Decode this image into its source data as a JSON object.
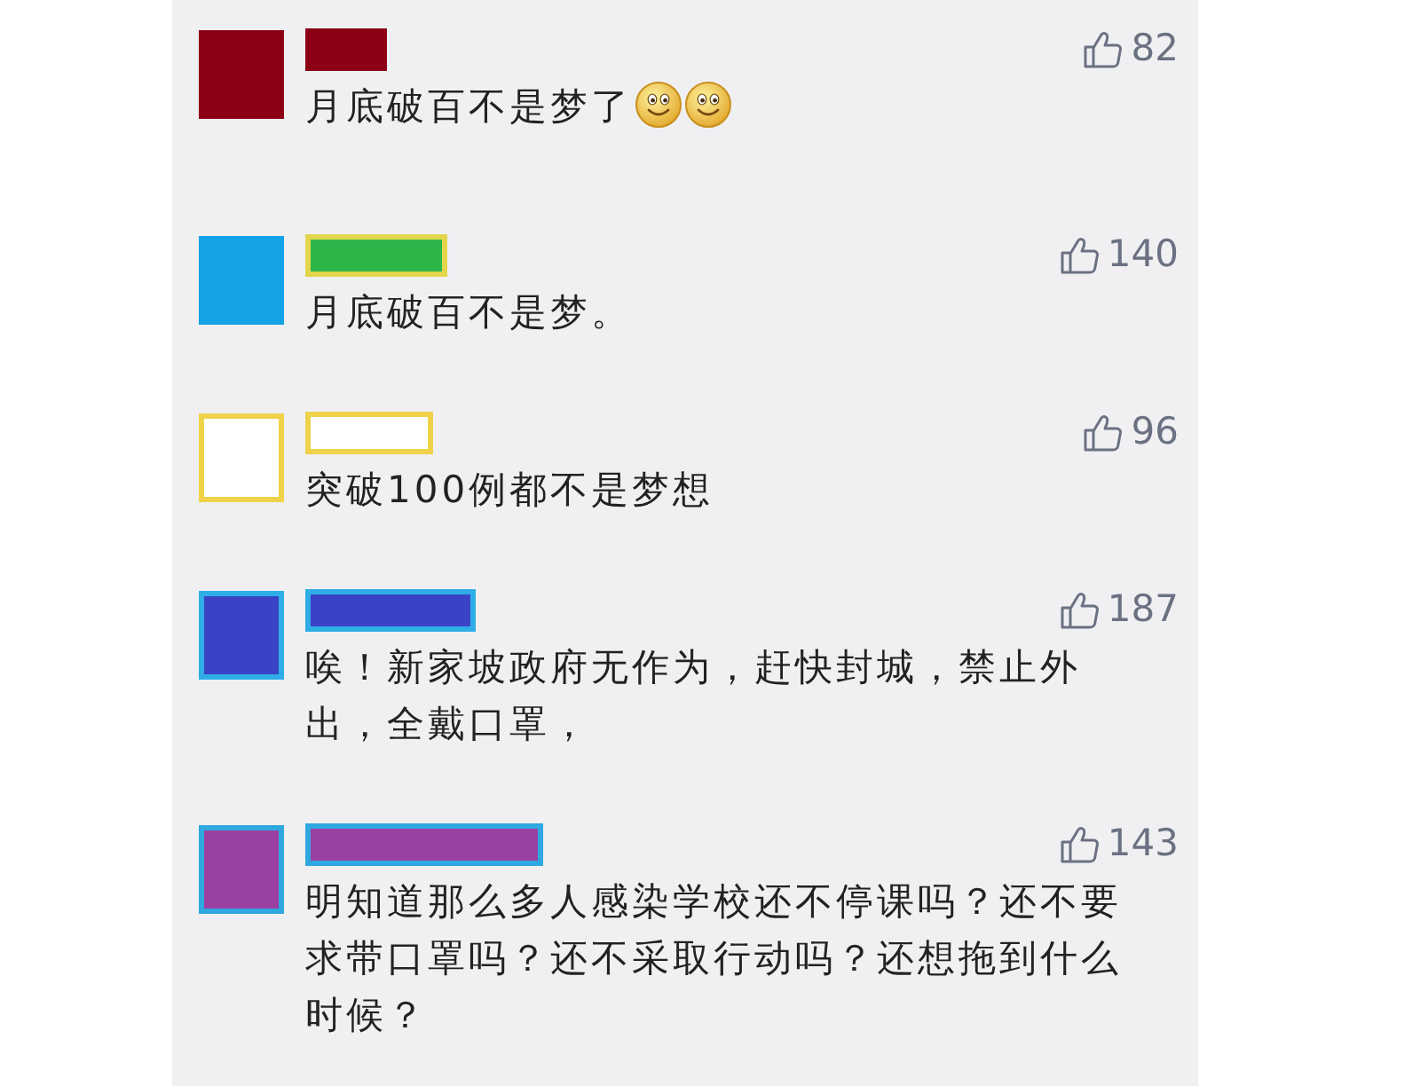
{
  "comments": [
    {
      "avatar": {
        "color": "#8b0014"
      },
      "name_bar": {
        "color": "#8b0014"
      },
      "text": "月底破百不是梦了",
      "emoticons": [
        {
          "kind": "smile"
        },
        {
          "kind": "smile"
        }
      ],
      "likes": "82"
    },
    {
      "avatar": {
        "color": "#14a3e6"
      },
      "name_bar": {
        "color": "#2cb64a",
        "outline": {
          "color": "#e4d64a"
        }
      },
      "text": "月底破百不是梦。",
      "likes": "140"
    },
    {
      "avatar": {
        "color": "#ffffff",
        "outline": {
          "color": "#efd24a"
        }
      },
      "name_bar": {
        "color": "#ffffff",
        "outline": {
          "color": "#efd24a"
        }
      },
      "text": "突破100例都不是梦想",
      "likes": "96"
    },
    {
      "avatar": {
        "color": "#3a42c6",
        "outline": {
          "color": "#2fade6"
        }
      },
      "name_bar": {
        "color": "#3a42c6",
        "outline": {
          "color": "#2fade6"
        }
      },
      "text": "唉！新家坡政府无作为，赶快封城，禁止外出，全戴口罩，",
      "likes": "187"
    },
    {
      "avatar": {
        "color": "#9a40a0",
        "outline": {
          "color": "#2fa8e0"
        }
      },
      "name_bar": {
        "color": "#9a40a0",
        "outline": {
          "color": "#2fa8e0"
        }
      },
      "text": "明知道那么多人感染学校还不停课吗？还不要求带口罩吗？还不采取行动吗？还想拖到什么时候？",
      "likes": "143"
    }
  ]
}
